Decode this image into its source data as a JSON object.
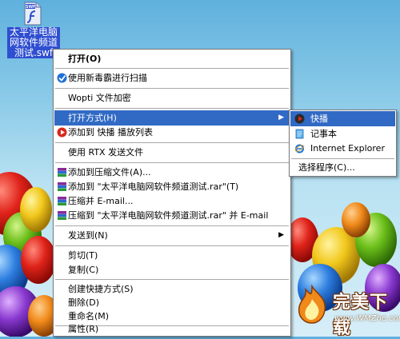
{
  "desktop_icon": {
    "badge": "SWF",
    "label_lines": [
      "太平洋电脑",
      "网软件频道",
      "测试.swf"
    ]
  },
  "context_menu": {
    "items": [
      {
        "label": "打开(O)",
        "bold": true
      },
      {
        "label": "使用新毒霸进行扫描",
        "icon": "shield-scan-icon"
      },
      {
        "label": "Wopti 文件加密"
      },
      {
        "label": "打开方式(H)",
        "submenu": true,
        "highlighted": true
      },
      {
        "label": "添加到 快播 播放列表",
        "icon": "qvod-icon"
      },
      {
        "label": "使用 RTX 发送文件"
      },
      {
        "label": "添加到压缩文件(A)...",
        "icon": "rar-icon"
      },
      {
        "label": "添加到 \"太平洋电脑网软件频道测试.rar\"(T)",
        "icon": "rar-icon"
      },
      {
        "label": "压缩并 E-mail...",
        "icon": "rar-icon"
      },
      {
        "label": "压缩到 \"太平洋电脑网软件频道测试.rar\" 并 E-mail",
        "icon": "rar-icon"
      },
      {
        "label": "发送到(N)",
        "submenu": true
      },
      {
        "label": "剪切(T)"
      },
      {
        "label": "复制(C)"
      },
      {
        "label": "创建快捷方式(S)"
      },
      {
        "label": "删除(D)"
      },
      {
        "label": "重命名(M)"
      },
      {
        "label": "属性(R)"
      }
    ]
  },
  "open_with_submenu": {
    "items": [
      {
        "label": "快播",
        "icon": "qvod-icon",
        "highlighted": true
      },
      {
        "label": "记事本",
        "icon": "notepad-icon"
      },
      {
        "label": "Internet Explorer",
        "icon": "ie-icon"
      },
      {
        "label": "选择程序(C)..."
      }
    ]
  },
  "watermark": {
    "brand": "完美下载",
    "url": "www.WMZhe.com"
  },
  "colors": {
    "highlight": "#316ac5",
    "desktop_sky": "#5fb1dd"
  }
}
